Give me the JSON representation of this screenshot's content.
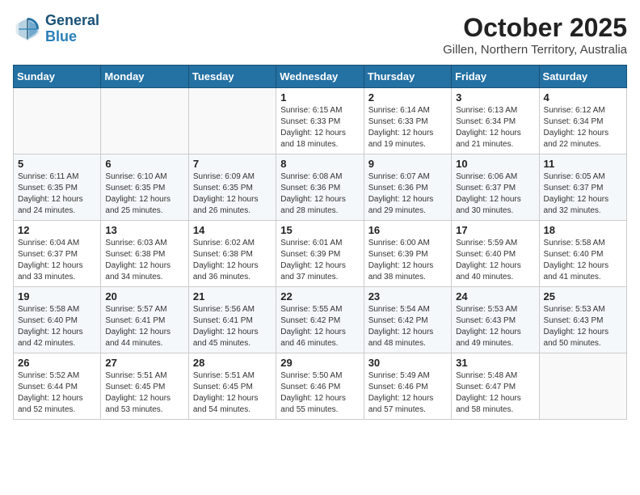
{
  "header": {
    "logo": {
      "general": "General",
      "blue": "Blue"
    },
    "title": "October 2025",
    "subtitle": "Gillen, Northern Territory, Australia"
  },
  "weekdays": [
    "Sunday",
    "Monday",
    "Tuesday",
    "Wednesday",
    "Thursday",
    "Friday",
    "Saturday"
  ],
  "weeks": [
    [
      {
        "day": "",
        "info": ""
      },
      {
        "day": "",
        "info": ""
      },
      {
        "day": "",
        "info": ""
      },
      {
        "day": "1",
        "info": "Sunrise: 6:15 AM\nSunset: 6:33 PM\nDaylight: 12 hours\nand 18 minutes."
      },
      {
        "day": "2",
        "info": "Sunrise: 6:14 AM\nSunset: 6:33 PM\nDaylight: 12 hours\nand 19 minutes."
      },
      {
        "day": "3",
        "info": "Sunrise: 6:13 AM\nSunset: 6:34 PM\nDaylight: 12 hours\nand 21 minutes."
      },
      {
        "day": "4",
        "info": "Sunrise: 6:12 AM\nSunset: 6:34 PM\nDaylight: 12 hours\nand 22 minutes."
      }
    ],
    [
      {
        "day": "5",
        "info": "Sunrise: 6:11 AM\nSunset: 6:35 PM\nDaylight: 12 hours\nand 24 minutes."
      },
      {
        "day": "6",
        "info": "Sunrise: 6:10 AM\nSunset: 6:35 PM\nDaylight: 12 hours\nand 25 minutes."
      },
      {
        "day": "7",
        "info": "Sunrise: 6:09 AM\nSunset: 6:35 PM\nDaylight: 12 hours\nand 26 minutes."
      },
      {
        "day": "8",
        "info": "Sunrise: 6:08 AM\nSunset: 6:36 PM\nDaylight: 12 hours\nand 28 minutes."
      },
      {
        "day": "9",
        "info": "Sunrise: 6:07 AM\nSunset: 6:36 PM\nDaylight: 12 hours\nand 29 minutes."
      },
      {
        "day": "10",
        "info": "Sunrise: 6:06 AM\nSunset: 6:37 PM\nDaylight: 12 hours\nand 30 minutes."
      },
      {
        "day": "11",
        "info": "Sunrise: 6:05 AM\nSunset: 6:37 PM\nDaylight: 12 hours\nand 32 minutes."
      }
    ],
    [
      {
        "day": "12",
        "info": "Sunrise: 6:04 AM\nSunset: 6:37 PM\nDaylight: 12 hours\nand 33 minutes."
      },
      {
        "day": "13",
        "info": "Sunrise: 6:03 AM\nSunset: 6:38 PM\nDaylight: 12 hours\nand 34 minutes."
      },
      {
        "day": "14",
        "info": "Sunrise: 6:02 AM\nSunset: 6:38 PM\nDaylight: 12 hours\nand 36 minutes."
      },
      {
        "day": "15",
        "info": "Sunrise: 6:01 AM\nSunset: 6:39 PM\nDaylight: 12 hours\nand 37 minutes."
      },
      {
        "day": "16",
        "info": "Sunrise: 6:00 AM\nSunset: 6:39 PM\nDaylight: 12 hours\nand 38 minutes."
      },
      {
        "day": "17",
        "info": "Sunrise: 5:59 AM\nSunset: 6:40 PM\nDaylight: 12 hours\nand 40 minutes."
      },
      {
        "day": "18",
        "info": "Sunrise: 5:58 AM\nSunset: 6:40 PM\nDaylight: 12 hours\nand 41 minutes."
      }
    ],
    [
      {
        "day": "19",
        "info": "Sunrise: 5:58 AM\nSunset: 6:40 PM\nDaylight: 12 hours\nand 42 minutes."
      },
      {
        "day": "20",
        "info": "Sunrise: 5:57 AM\nSunset: 6:41 PM\nDaylight: 12 hours\nand 44 minutes."
      },
      {
        "day": "21",
        "info": "Sunrise: 5:56 AM\nSunset: 6:41 PM\nDaylight: 12 hours\nand 45 minutes."
      },
      {
        "day": "22",
        "info": "Sunrise: 5:55 AM\nSunset: 6:42 PM\nDaylight: 12 hours\nand 46 minutes."
      },
      {
        "day": "23",
        "info": "Sunrise: 5:54 AM\nSunset: 6:42 PM\nDaylight: 12 hours\nand 48 minutes."
      },
      {
        "day": "24",
        "info": "Sunrise: 5:53 AM\nSunset: 6:43 PM\nDaylight: 12 hours\nand 49 minutes."
      },
      {
        "day": "25",
        "info": "Sunrise: 5:53 AM\nSunset: 6:43 PM\nDaylight: 12 hours\nand 50 minutes."
      }
    ],
    [
      {
        "day": "26",
        "info": "Sunrise: 5:52 AM\nSunset: 6:44 PM\nDaylight: 12 hours\nand 52 minutes."
      },
      {
        "day": "27",
        "info": "Sunrise: 5:51 AM\nSunset: 6:45 PM\nDaylight: 12 hours\nand 53 minutes."
      },
      {
        "day": "28",
        "info": "Sunrise: 5:51 AM\nSunset: 6:45 PM\nDaylight: 12 hours\nand 54 minutes."
      },
      {
        "day": "29",
        "info": "Sunrise: 5:50 AM\nSunset: 6:46 PM\nDaylight: 12 hours\nand 55 minutes."
      },
      {
        "day": "30",
        "info": "Sunrise: 5:49 AM\nSunset: 6:46 PM\nDaylight: 12 hours\nand 57 minutes."
      },
      {
        "day": "31",
        "info": "Sunrise: 5:48 AM\nSunset: 6:47 PM\nDaylight: 12 hours\nand 58 minutes."
      },
      {
        "day": "",
        "info": ""
      }
    ]
  ]
}
